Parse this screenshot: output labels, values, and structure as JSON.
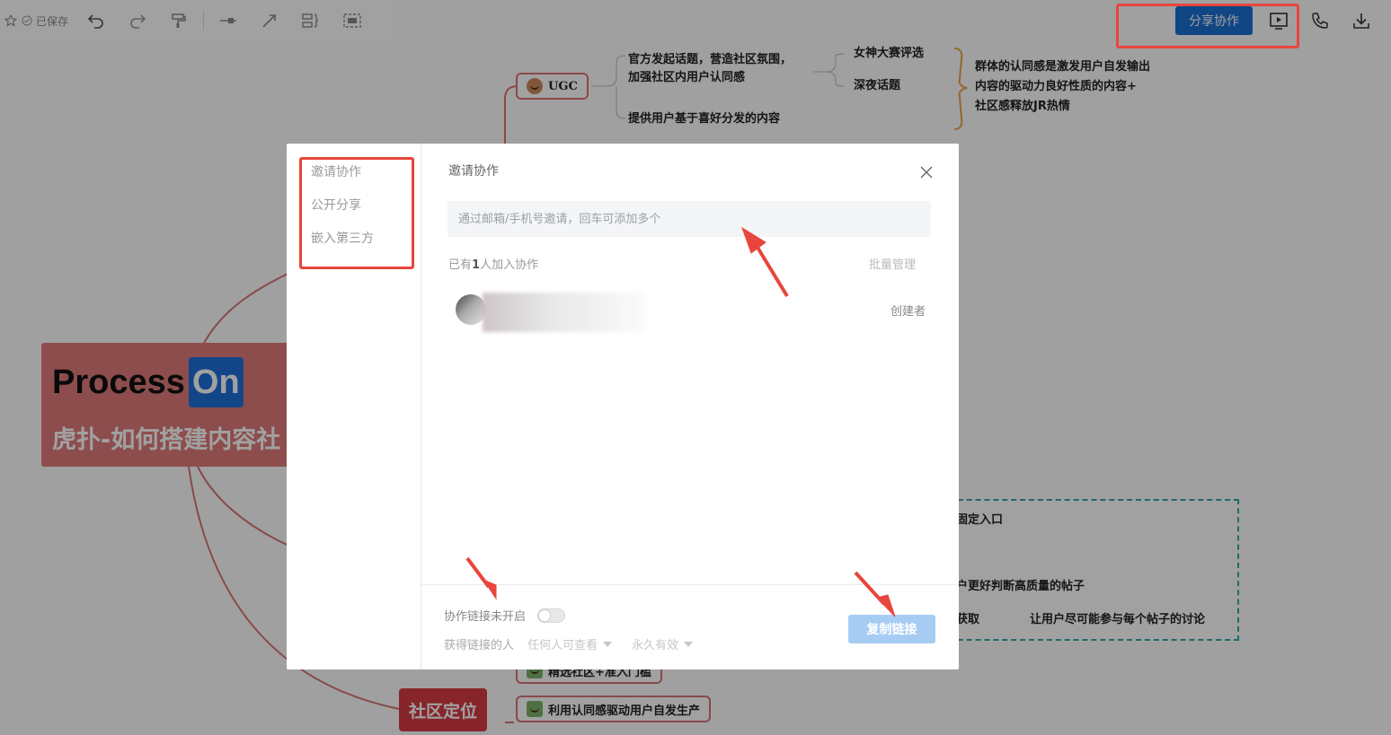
{
  "toolbar": {
    "saved_status": "已保存",
    "share_button": "分享协作"
  },
  "mindmap": {
    "root_logo_word": "Process",
    "root_logo_badge": "On",
    "root_title": "虎扑-如何搭建内容社",
    "ugc_node": "UGC",
    "ugc_branch1_line1": "官方发起话题，营造社区氛围，",
    "ugc_branch1_line2": "加强社区内用户认同感",
    "ugc_branch2": "提供用户基于喜好分发的内容",
    "leaf_goddess": "女神大赛评选",
    "leaf_night": "深夜话题",
    "brace_note_line1": "群体的认同感是激发用户自发输出",
    "brace_note_line2": "内容的驱动力良好性质的内容+",
    "brace_note_line3": "社区感释放JR热情",
    "dash_text1": "固定入口",
    "dash_text2": "户更好判断高质量的帖子",
    "dash_text3": "获取",
    "dash_text4": "让用户尽可能参与每个帖子的讨论",
    "position_node": "社区定位",
    "sub_node1": "精选社区+准入门槛",
    "sub_node2": "利用认同感驱动用户自发生产"
  },
  "modal": {
    "sidebar": {
      "items": [
        "邀请协作",
        "公开分享",
        "嵌入第三方"
      ]
    },
    "heading": "邀请协作",
    "invite_placeholder": "通过邮箱/手机号邀请，回车可添加多个",
    "member_count_prefix": "已有",
    "member_count_number": "1",
    "member_count_suffix": "人加入协作",
    "batch_manage": "批量管理",
    "member_role": "创建者",
    "footer": {
      "link_status": "协作链接未开启",
      "link_getter_label": "获得链接的人",
      "permission_select": "任何人可查看",
      "validity_select": "永久有效",
      "copy_link_button": "复制链接"
    }
  },
  "colors": {
    "accent": "#1c6fd1",
    "annotation": "#e8453c",
    "root": "#e07a7a",
    "position_node": "#d63c45"
  }
}
